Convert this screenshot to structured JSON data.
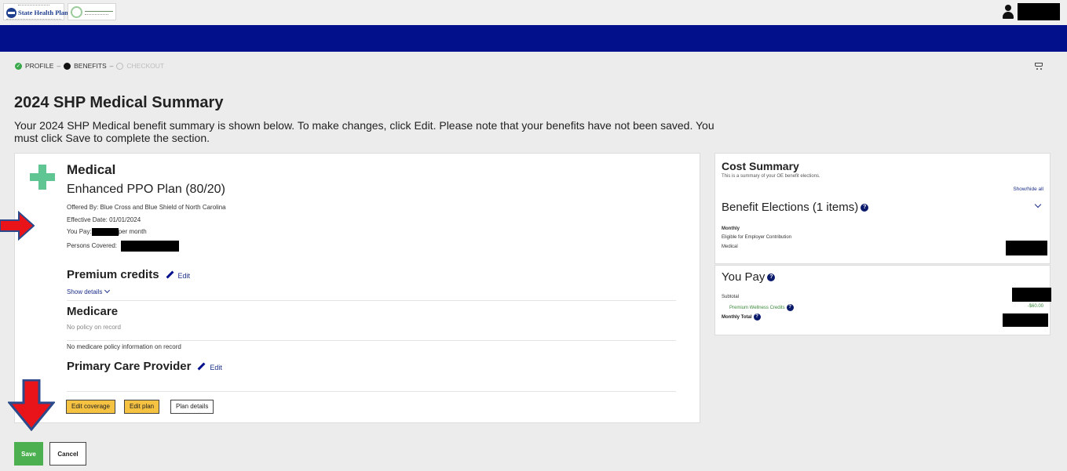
{
  "header": {
    "logo_text": "State Health Plan",
    "logo_alt": "Treasurer seal"
  },
  "steps": {
    "profile": "PROFILE",
    "benefits": "BENEFITS",
    "checkout": "CHECKOUT",
    "separator": "–"
  },
  "page": {
    "title": "2024 SHP Medical Summary",
    "intro": "Your 2024 SHP Medical benefit summary is shown below. To make changes, click Edit. Please note that your benefits have not been saved. You must click Save to complete the section."
  },
  "medical": {
    "title": "Medical",
    "plan": "Enhanced PPO Plan (80/20)",
    "offered_by": "Offered By: Blue Cross and Blue Shield of North Carolina",
    "effective_date": "Effective Date: 01/01/2024",
    "you_pay_label": "You Pay:",
    "per_month": "per month",
    "persons_covered_label": "Persons Covered:"
  },
  "premium_credits": {
    "title": "Premium credits",
    "edit": "Edit",
    "show_details": "Show details"
  },
  "medicare": {
    "title": "Medicare",
    "no_policy": "No policy on record",
    "no_info": "No medicare policy information on record"
  },
  "pcp": {
    "title": "Primary Care Provider",
    "edit": "Edit"
  },
  "buttons": {
    "edit_coverage": "Edit coverage",
    "edit_plan": "Edit plan",
    "plan_details": "Plan details",
    "save": "Save",
    "cancel": "Cancel"
  },
  "cost_summary": {
    "title": "Cost Summary",
    "subtitle": "This is a summary of your OE benefit elections.",
    "show_hide": "Show/hide all",
    "benefit_elections": "Benefit Elections (1 items)",
    "monthly": "Monthly",
    "eligible": "Eligible for Employer Contribution",
    "medical": "Medical"
  },
  "you_pay": {
    "title": "You Pay",
    "subtotal": "Subtotal",
    "wellness_label": "Premium Wellness Credits",
    "wellness_value": "-$60.00",
    "monthly_total": "Monthly Total"
  },
  "colors": {
    "nav_band": "#02108c",
    "save_green": "#4cb050",
    "edit_yellow": "#f5c242",
    "medical_plus": "#5fc693",
    "arrow_red": "#e8141a",
    "arrow_outline": "#2b4a8c"
  }
}
